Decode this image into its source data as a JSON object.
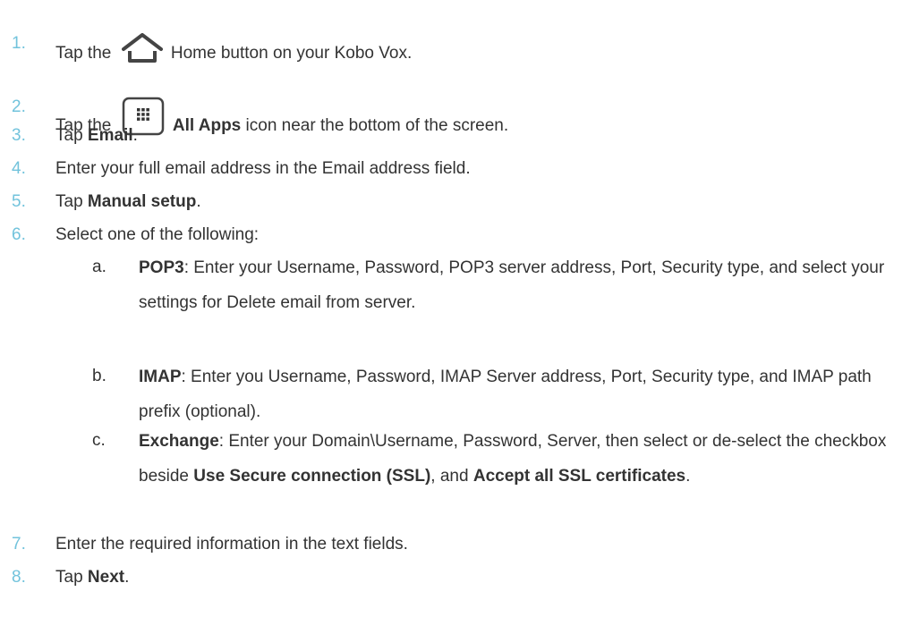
{
  "steps": [
    {
      "num": "1.",
      "pre": "Tap the",
      "icon": "home-icon",
      "post": "Home button on your Kobo Vox."
    },
    {
      "num": "2.",
      "pre": "Tap the",
      "icon": "all-apps-icon",
      "bold": "All Apps",
      "post": " icon near the bottom of the screen."
    },
    {
      "num": "3.",
      "pre": "Tap ",
      "bold": "Email",
      "post": "."
    },
    {
      "num": "4.",
      "text": "Enter your full email address in the Email address field."
    },
    {
      "num": "5.",
      "pre": "Tap ",
      "bold": "Manual setup",
      "post": "."
    },
    {
      "num": "6.",
      "text": "Select one of the following:"
    },
    {
      "num": "7.",
      "text": "Enter the required information in the text fields."
    },
    {
      "num": "8.",
      "pre": "Tap ",
      "bold": "Next",
      "post": "."
    }
  ],
  "substeps": [
    {
      "letter": "a.",
      "bold": "POP3",
      "text": ": Enter your Username, Password, POP3 server address, Port, Security type, and select your settings for Delete email from server."
    },
    {
      "letter": "b.",
      "bold": "IMAP",
      "text": ": Enter you Username, Password, IMAP Server address, Port, Security type, and IMAP path prefix (optional)."
    },
    {
      "letter": "c.",
      "bold": "Exchange",
      "text": ": Enter your Domain\\Username, Password, Server, then select or de-select the checkbox beside ",
      "bold2": "Use Secure connection (SSL)",
      "text2": ", and ",
      "bold3": "Accept all SSL certificates",
      "text3": "."
    }
  ],
  "colors": {
    "number": "#72c3dc",
    "text": "#333333"
  }
}
